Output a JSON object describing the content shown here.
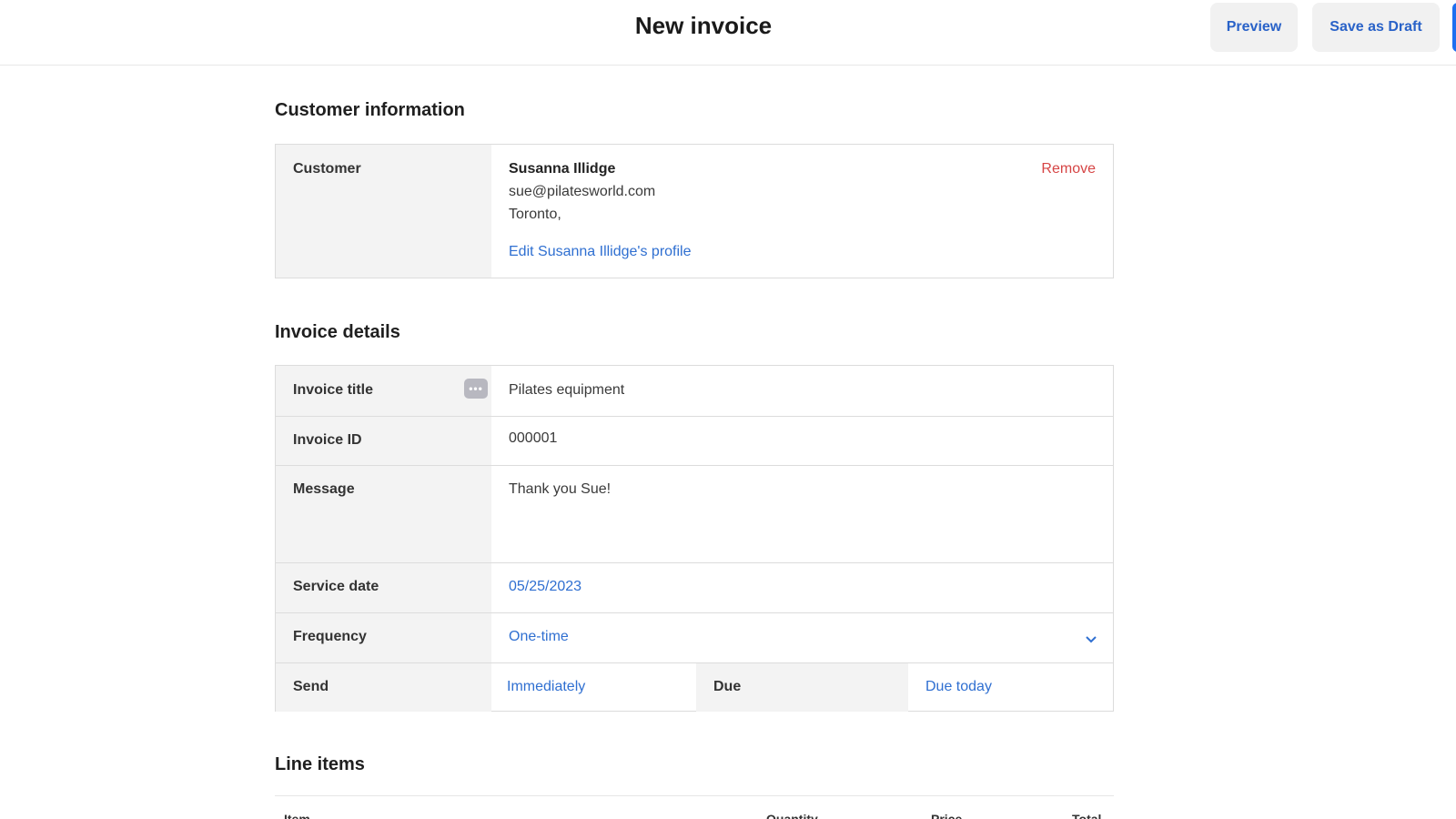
{
  "header": {
    "title": "New invoice",
    "preview_label": "Preview",
    "draft_label": "Save as Draft"
  },
  "customer_section": {
    "title": "Customer information",
    "label": "Customer",
    "name": "Susanna Illidge",
    "email": "sue@pilatesworld.com",
    "city": "Toronto,",
    "remove_label": "Remove",
    "edit_link": "Edit Susanna Illidge's profile"
  },
  "invoice_section": {
    "title": "Invoice details",
    "fields": {
      "title_label": "Invoice title",
      "title_value": "Pilates equipment",
      "id_label": "Invoice ID",
      "id_value": "000001",
      "message_label": "Message",
      "message_value": "Thank you Sue!",
      "service_date_label": "Service date",
      "service_date_value": "05/25/2023",
      "frequency_label": "Frequency",
      "frequency_value": "One-time",
      "send_label": "Send",
      "send_value": "Immediately",
      "due_label": "Due",
      "due_value": "Due today"
    },
    "more_icon": "more-options-icon"
  },
  "line_items": {
    "title": "Line items",
    "columns": [
      "Item",
      "Quantity",
      "Price",
      "Total"
    ]
  },
  "colors": {
    "accent": "#2f6fd1",
    "remove": "#d64545",
    "primary_button": "#1e6ff0"
  }
}
